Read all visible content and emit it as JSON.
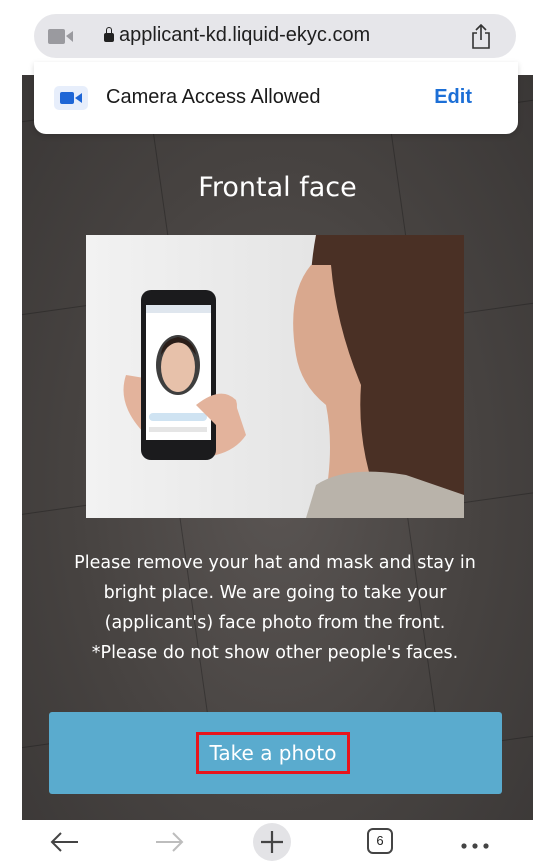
{
  "browser": {
    "url": "applicant-kd.liquid-ekyc.com",
    "tab_count": "6"
  },
  "banner": {
    "text": "Camera Access Allowed",
    "edit_label": "Edit"
  },
  "page": {
    "title": "Frontal face",
    "description_lines": [
      "Please remove your hat and mask and stay in",
      "bright place. We are going to take your",
      "(applicant's) face photo from the front.",
      "*Please do not show other people's faces."
    ],
    "button_label": "Take a photo"
  },
  "colors": {
    "button": "#5aabce",
    "highlight_border": "#e8141c",
    "link": "#1c6fd6"
  }
}
